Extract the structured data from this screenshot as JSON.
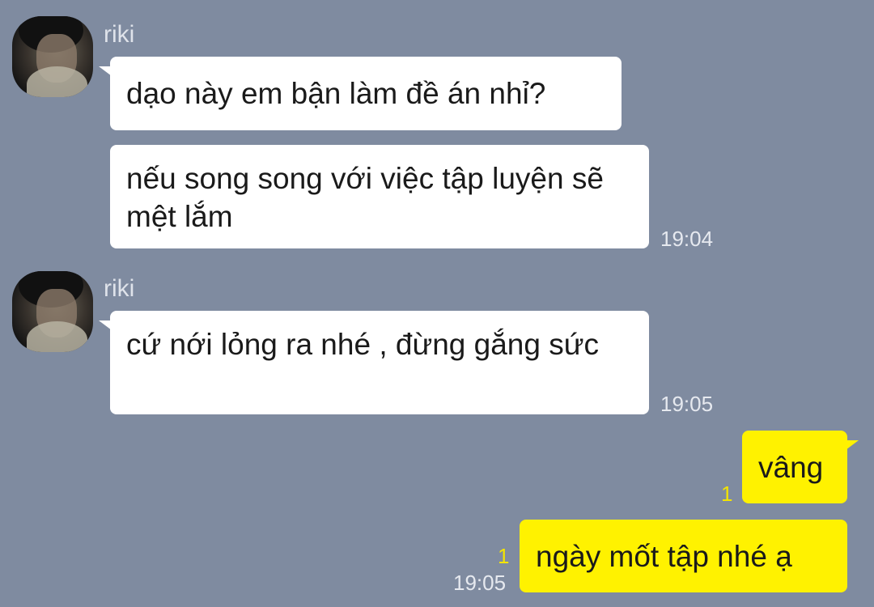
{
  "messages": [
    {
      "sender": "riki",
      "text": "dạo này em bận làm đề án nhỉ?"
    },
    {
      "sender": "riki",
      "text": "nếu song song với việc tập luyện sẽ mệt lắm",
      "time": "19:04"
    },
    {
      "sender": "riki",
      "text": "cứ nới lỏng ra nhé , đừng gắng sức",
      "time": "19:05"
    },
    {
      "sender": "me",
      "text": "vâng",
      "unread": "1"
    },
    {
      "sender": "me",
      "text": "ngày mốt tập nhé ạ",
      "unread": "1",
      "time": "19:05"
    }
  ],
  "sender_name": "riki",
  "colors": {
    "background": "#7f8ba0",
    "incoming_bubble": "#ffffff",
    "outgoing_bubble": "#fff200",
    "unread_count": "#f3e400"
  },
  "icons": {
    "avatar": "profile-photo"
  }
}
